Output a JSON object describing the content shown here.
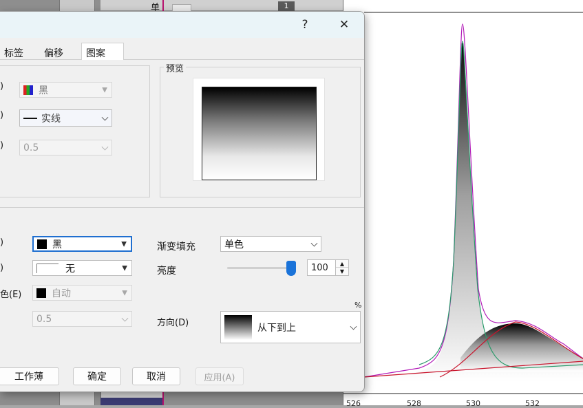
{
  "background": {
    "top_label": "单",
    "sheet_tab": "1",
    "x_ticks": [
      "526",
      "528",
      "530",
      "532"
    ]
  },
  "dialog": {
    "help_symbol": "?",
    "close_symbol": "✕",
    "tabs": [
      "标签",
      "偏移",
      "图案"
    ],
    "active_tab": "图案",
    "border": {
      "color_label": ")",
      "color_value": "黑",
      "style_label": ")",
      "style_value": "实线",
      "width_label": ")",
      "width_value": "0.5"
    },
    "preview": {
      "legend": "预览"
    },
    "fill": {
      "color_label": ")",
      "color_value": "黑",
      "pattern_label": ")",
      "pattern_value": "无",
      "pattern_color_label": "色(E)",
      "pattern_color_value": "自动",
      "pattern_width_value": "0.5",
      "gradient_label": "渐变填充",
      "gradient_value": "单色",
      "brightness_label": "亮度",
      "brightness_value": "100",
      "brightness_level": 1.0,
      "percent_sign": "%",
      "direction_label": "方向(D)",
      "direction_value": "从下到上"
    },
    "buttons": {
      "workbook": "工作薄",
      "ok": "确定",
      "cancel": "取消",
      "apply": "应用(A)"
    }
  },
  "colors": {
    "accent": "#1f6fd0",
    "slider_thumb": "#1a73d9",
    "curve_total": "#b21cb8",
    "curve_peak": "#2a9a6a",
    "curve_baseline": "#c8142c"
  }
}
